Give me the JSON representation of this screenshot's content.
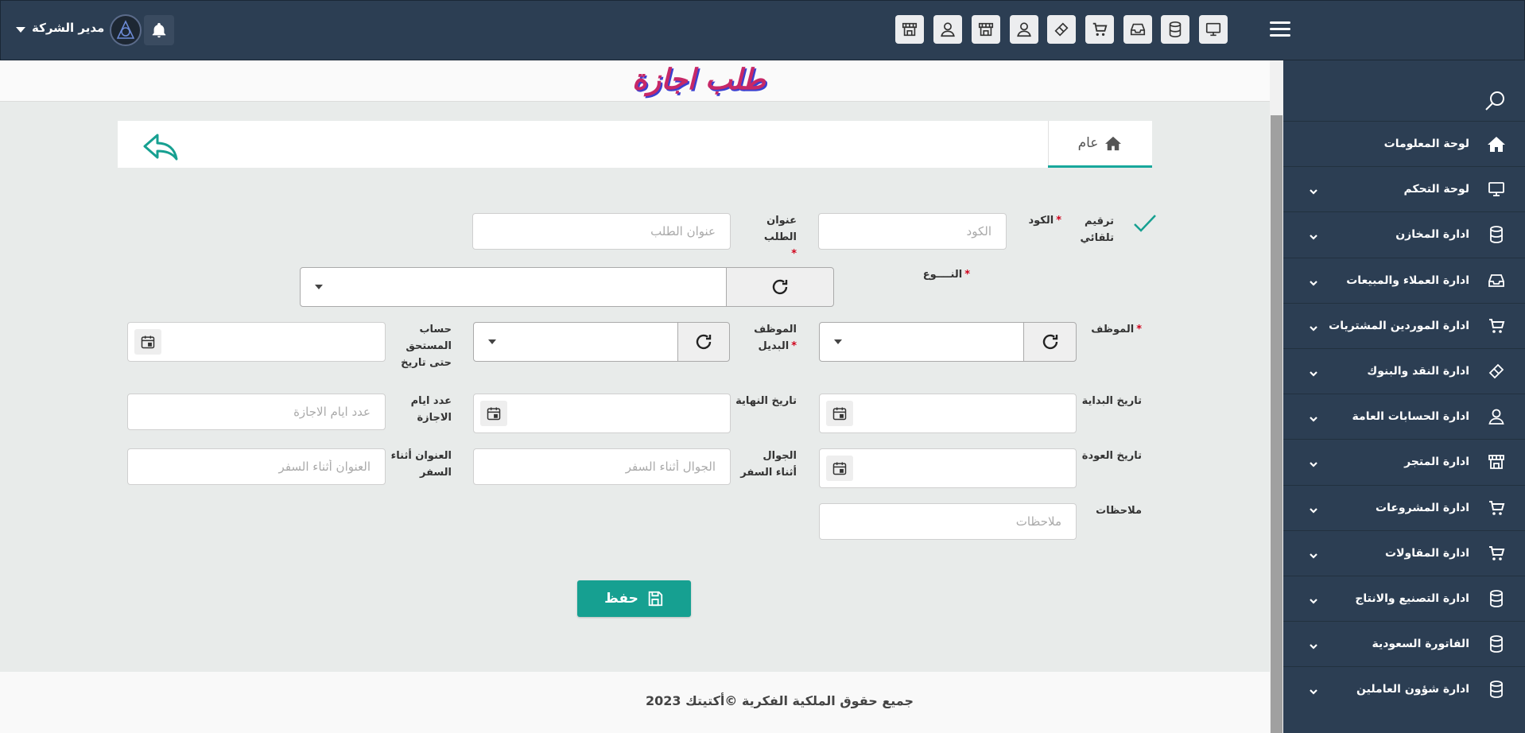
{
  "header": {
    "user_name": "مدير الشركة"
  },
  "page": {
    "title": "طلب اجازة"
  },
  "tabs": [
    {
      "label": "عام"
    }
  ],
  "sidebar": {
    "items": [
      {
        "label": "لوحة المعلومات",
        "icon": "home-icon",
        "has_submenu": false
      },
      {
        "label": "لوحة التحكم",
        "icon": "monitor-icon",
        "has_submenu": true
      },
      {
        "label": "ادارة المخازن",
        "icon": "database-icon",
        "has_submenu": true
      },
      {
        "label": "ادارة العملاء والمبيعات",
        "icon": "inbox-icon",
        "has_submenu": true
      },
      {
        "label": "ادارة الموردين المشتريات",
        "icon": "cart-icon",
        "has_submenu": true
      },
      {
        "label": "ادارة النقد والبنوك",
        "icon": "ticket-icon",
        "has_submenu": true
      },
      {
        "label": "ادارة الحسابات العامة",
        "icon": "user-icon",
        "has_submenu": true
      },
      {
        "label": "ادارة المتجر",
        "icon": "store-icon",
        "has_submenu": true
      },
      {
        "label": "ادارة المشروعات",
        "icon": "cart-icon",
        "has_submenu": true
      },
      {
        "label": "ادارة المقاولات",
        "icon": "cart-icon",
        "has_submenu": true
      },
      {
        "label": "ادارة التصنيع والانتاج",
        "icon": "database-icon",
        "has_submenu": true
      },
      {
        "label": "الفاتورة السعودية",
        "icon": "database-icon",
        "has_submenu": true
      },
      {
        "label": "ادارة شؤون العاملين",
        "icon": "database-icon",
        "has_submenu": true
      }
    ]
  },
  "form": {
    "auto_number_label": "ترقيم تلقائي",
    "code_label": "الكود",
    "code_placeholder": "الكود",
    "request_title_label": "عنوان الطلب",
    "request_title_placeholder": "عنوان الطلب",
    "type_label": "النــــوع",
    "employee_label": "الموظف",
    "substitute_label": "الموظف البديل",
    "entitlement_label": "حساب المستحق حتى تاريخ",
    "start_date_label": "تاريخ البداية",
    "end_date_label": "تاريخ النهاية",
    "leave_days_label": "عدد ايام الاجازة",
    "leave_days_placeholder": "عدد ايام الاجازة",
    "return_date_label": "تاريخ العودة",
    "travel_mobile_label": "الجوال أثناء السفر",
    "travel_mobile_placeholder": "الجوال أثناء السفر",
    "travel_address_label": "العنوان أثناء السفر",
    "travel_address_placeholder": "العنوان أثناء السفر",
    "notes_label": "ملاحظات",
    "notes_placeholder": "ملاحظات",
    "required_mark": "*"
  },
  "actions": {
    "save_label": "حفظ"
  },
  "footer": {
    "text": "جميع حقوق الملكية الفكرية ©أكتيتك 2023"
  },
  "colors": {
    "navy": "#2c3e53",
    "teal": "#16a091",
    "title_pink": "#c72867",
    "title_shadow": "#3b3fd0",
    "required": "#d0021b"
  }
}
